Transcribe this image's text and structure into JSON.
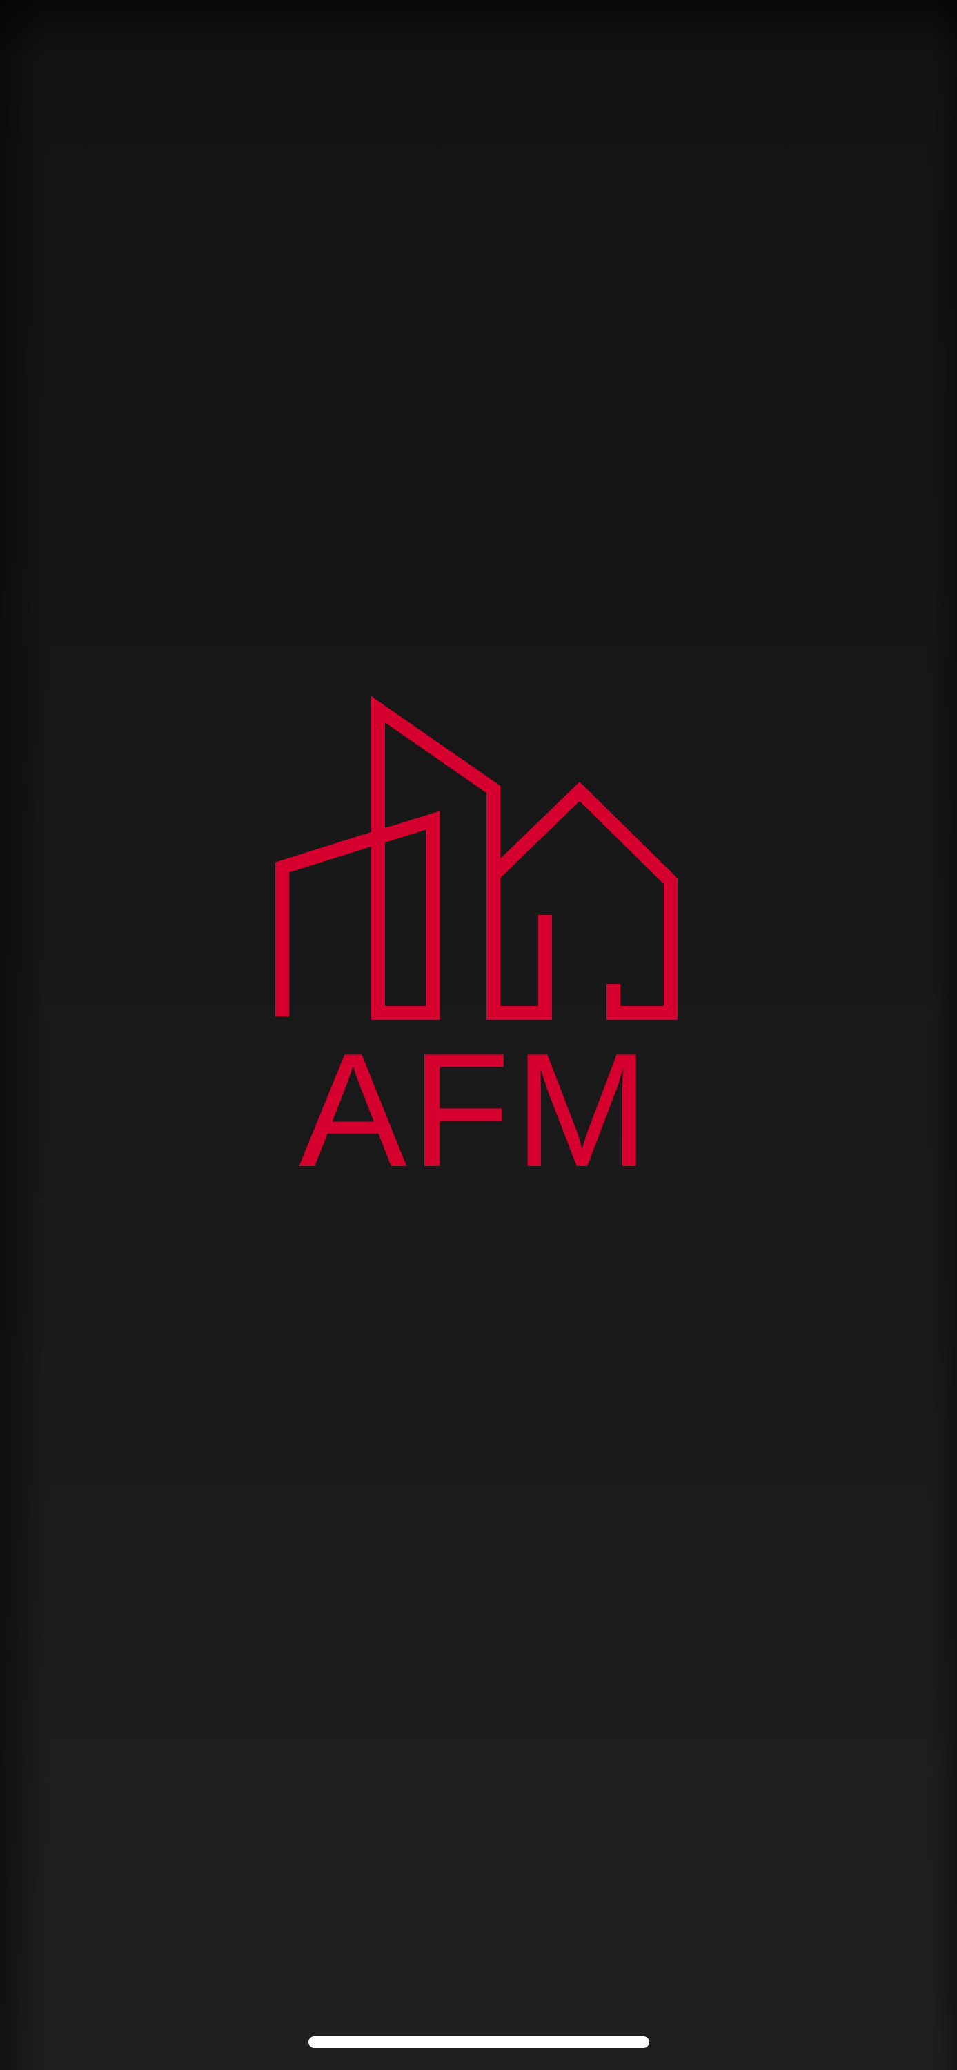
{
  "app": {
    "logo": {
      "icon": "buildings-house-outline-icon",
      "wordmark": "AFM",
      "color": "#d6002f"
    }
  },
  "system": {
    "home_indicator": "home-indicator"
  }
}
